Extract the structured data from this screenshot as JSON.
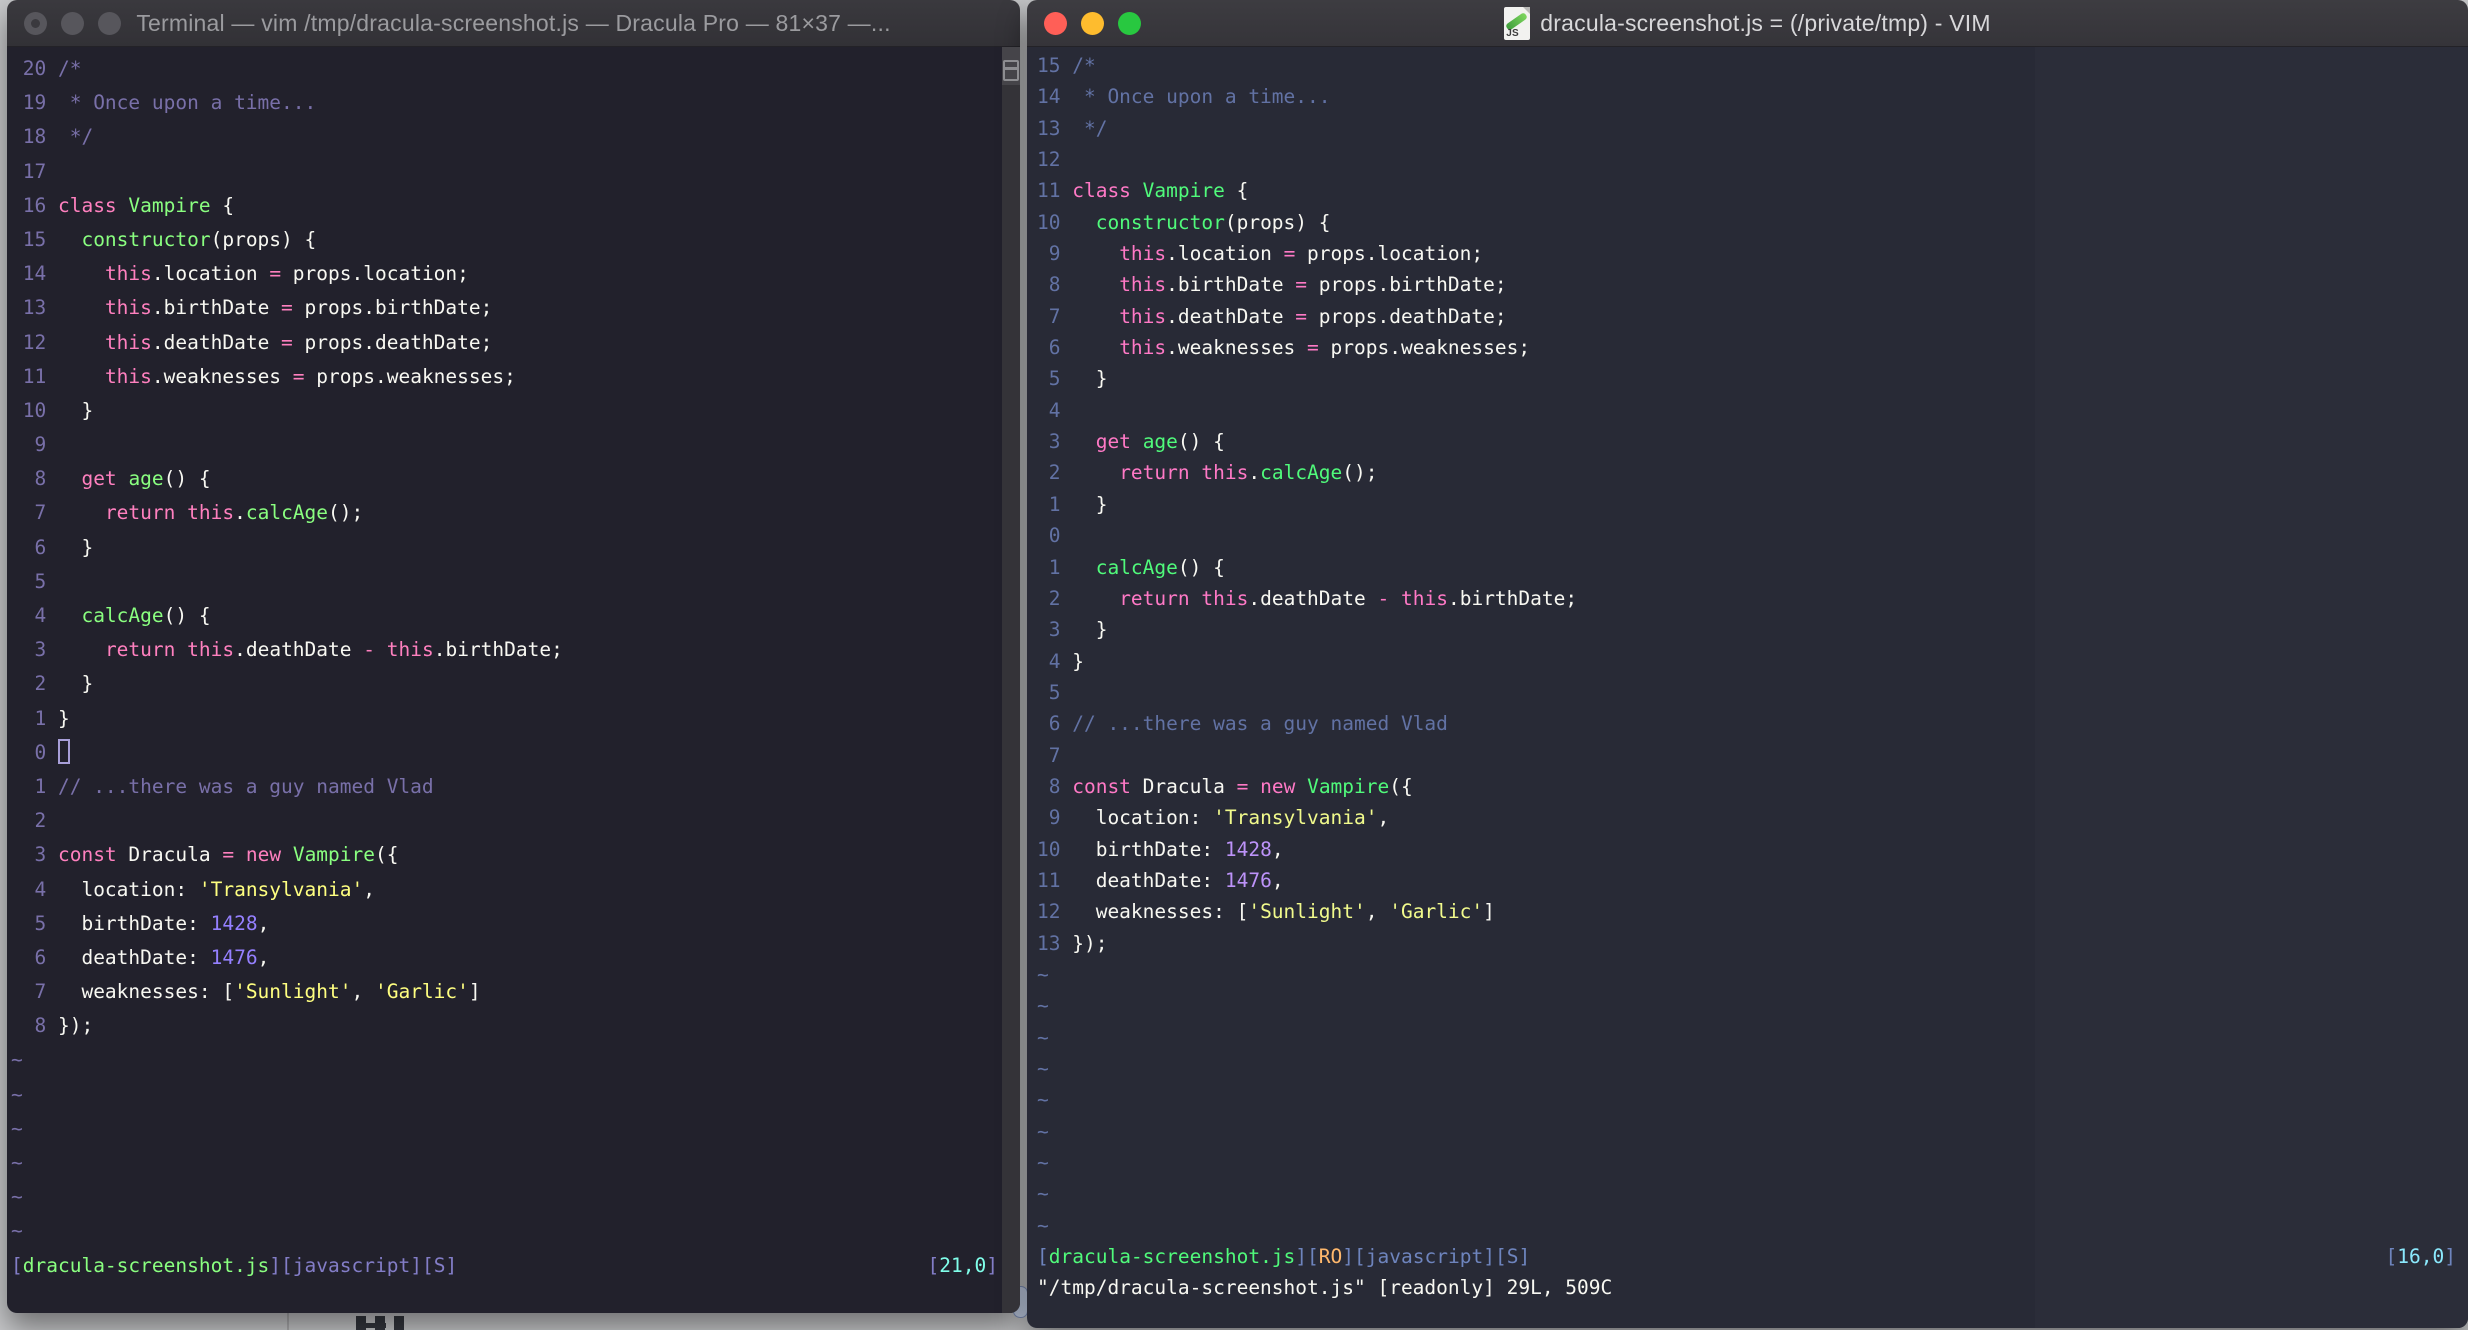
{
  "desktop": {
    "background": "#c8c9cb"
  },
  "left_window": {
    "app": "Terminal",
    "title": "Terminal — vim /tmp/dracula-screenshot.js — Dracula Pro — 81×37 —...",
    "theme_name": "Dracula Pro",
    "status": {
      "file": "dracula-screenshot.js",
      "flags": [
        "javascript",
        "S"
      ],
      "ruler": "21,0"
    },
    "command_line": "",
    "tilde_count": 6,
    "cursor": {
      "line": 21,
      "col": 0,
      "style": "hollow"
    },
    "gutter": [
      "20",
      "19",
      "18",
      "17",
      "16",
      "15",
      "14",
      "13",
      "12",
      "11",
      "10",
      "9",
      "8",
      "7",
      "6",
      "5",
      "4",
      "3",
      "2",
      "1",
      "0",
      "1",
      "2",
      "3",
      "4",
      "5",
      "6",
      "7",
      "8"
    ],
    "palette": {
      "background": "#22212c",
      "foreground": "#f8f8f2",
      "comment": "#7970a9",
      "pink": "#ff80bf",
      "green": "#8aff80",
      "yellow": "#ffff80",
      "purple": "#9580ff",
      "cyan": "#80ffea",
      "orange": "#ffca80"
    }
  },
  "right_window": {
    "app": "MacVim",
    "title": "dracula-screenshot.js = (/private/tmp) - VIM",
    "file_icon_label": "JS",
    "status": {
      "file": "dracula-screenshot.js",
      "readonly_flag": "RO",
      "flags": [
        "javascript",
        "S"
      ],
      "ruler": "16,0"
    },
    "command_line": "\"/tmp/dracula-screenshot.js\" [readonly] 29L, 509C",
    "tilde_count": 9,
    "cursor": {
      "line": 16,
      "col": 0,
      "style": "none"
    },
    "gutter": [
      "15",
      "14",
      "13",
      "12",
      "11",
      "10",
      "9",
      "8",
      "7",
      "6",
      "5",
      "4",
      "3",
      "2",
      "1",
      "0",
      "1",
      "2",
      "3",
      "4",
      "5",
      "6",
      "7",
      "8",
      "9",
      "10",
      "11",
      "12",
      "13"
    ],
    "palette": {
      "background": "#282a36",
      "foreground": "#f8f8f2",
      "comment": "#6272a4",
      "pink": "#ff79c6",
      "green": "#50fa7b",
      "yellow": "#f1fa8c",
      "purple": "#bd93f9",
      "cyan": "#8be9fd",
      "orange": "#ffb86c"
    }
  },
  "tilde_char": "~",
  "code_lines": [
    {
      "segs": [
        [
          "c",
          "/*"
        ]
      ]
    },
    {
      "segs": [
        [
          "c",
          " * Once upon a time..."
        ]
      ]
    },
    {
      "segs": [
        [
          "c",
          " */"
        ]
      ]
    },
    {
      "segs": []
    },
    {
      "segs": [
        [
          "k",
          "class"
        ],
        [
          "f",
          " "
        ],
        [
          "g",
          "Vampire"
        ],
        [
          "f",
          " {"
        ]
      ]
    },
    {
      "segs": [
        [
          "f",
          "  "
        ],
        [
          "g",
          "constructor"
        ],
        [
          "f",
          "(props) {"
        ]
      ]
    },
    {
      "segs": [
        [
          "f",
          "    "
        ],
        [
          "k",
          "this"
        ],
        [
          "f",
          ".location "
        ],
        [
          "k",
          "="
        ],
        [
          "f",
          " props.location;"
        ]
      ]
    },
    {
      "segs": [
        [
          "f",
          "    "
        ],
        [
          "k",
          "this"
        ],
        [
          "f",
          ".birthDate "
        ],
        [
          "k",
          "="
        ],
        [
          "f",
          " props.birthDate;"
        ]
      ]
    },
    {
      "segs": [
        [
          "f",
          "    "
        ],
        [
          "k",
          "this"
        ],
        [
          "f",
          ".deathDate "
        ],
        [
          "k",
          "="
        ],
        [
          "f",
          " props.deathDate;"
        ]
      ]
    },
    {
      "segs": [
        [
          "f",
          "    "
        ],
        [
          "k",
          "this"
        ],
        [
          "f",
          ".weaknesses "
        ],
        [
          "k",
          "="
        ],
        [
          "f",
          " props.weaknesses;"
        ]
      ]
    },
    {
      "segs": [
        [
          "f",
          "  }"
        ]
      ]
    },
    {
      "segs": []
    },
    {
      "segs": [
        [
          "f",
          "  "
        ],
        [
          "k",
          "get"
        ],
        [
          "f",
          " "
        ],
        [
          "g",
          "age"
        ],
        [
          "f",
          "() {"
        ]
      ]
    },
    {
      "segs": [
        [
          "f",
          "    "
        ],
        [
          "k",
          "return"
        ],
        [
          "f",
          " "
        ],
        [
          "k",
          "this"
        ],
        [
          "f",
          "."
        ],
        [
          "g",
          "calcAge"
        ],
        [
          "f",
          "();"
        ]
      ]
    },
    {
      "segs": [
        [
          "f",
          "  }"
        ]
      ]
    },
    {
      "segs": []
    },
    {
      "segs": [
        [
          "f",
          "  "
        ],
        [
          "g",
          "calcAge"
        ],
        [
          "f",
          "() {"
        ]
      ]
    },
    {
      "segs": [
        [
          "f",
          "    "
        ],
        [
          "k",
          "return"
        ],
        [
          "f",
          " "
        ],
        [
          "k",
          "this"
        ],
        [
          "f",
          ".deathDate "
        ],
        [
          "k",
          "-"
        ],
        [
          "f",
          " "
        ],
        [
          "k",
          "this"
        ],
        [
          "f",
          ".birthDate;"
        ]
      ]
    },
    {
      "segs": [
        [
          "f",
          "  }"
        ]
      ]
    },
    {
      "segs": [
        [
          "f",
          "}"
        ]
      ]
    },
    {
      "segs": []
    },
    {
      "segs": [
        [
          "c",
          "// ...there was a guy named Vlad"
        ]
      ]
    },
    {
      "segs": []
    },
    {
      "segs": [
        [
          "k",
          "const"
        ],
        [
          "f",
          " Dracula "
        ],
        [
          "k",
          "="
        ],
        [
          "f",
          " "
        ],
        [
          "k",
          "new"
        ],
        [
          "f",
          " "
        ],
        [
          "g",
          "Vampire"
        ],
        [
          "f",
          "({"
        ]
      ]
    },
    {
      "segs": [
        [
          "f",
          "  location: "
        ],
        [
          "s",
          "'Transylvania'"
        ],
        [
          "f",
          ","
        ]
      ]
    },
    {
      "segs": [
        [
          "f",
          "  birthDate: "
        ],
        [
          "n",
          "1428"
        ],
        [
          "f",
          ","
        ]
      ]
    },
    {
      "segs": [
        [
          "f",
          "  deathDate: "
        ],
        [
          "n",
          "1476"
        ],
        [
          "f",
          ","
        ]
      ]
    },
    {
      "segs": [
        [
          "f",
          "  weaknesses: ["
        ],
        [
          "s",
          "'Sunlight'"
        ],
        [
          "f",
          ", "
        ],
        [
          "s",
          "'Garlic'"
        ],
        [
          "f",
          "]"
        ]
      ]
    },
    {
      "segs": [
        [
          "f",
          "});"
        ]
      ]
    }
  ]
}
